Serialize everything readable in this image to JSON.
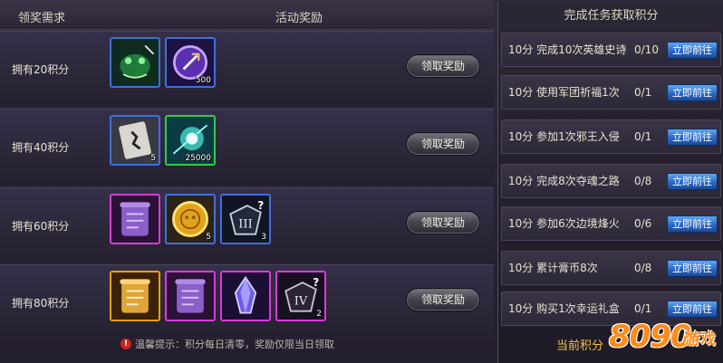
{
  "header": {
    "col_requirement": "领奖需求",
    "col_rewards": "活动奖励"
  },
  "rows": [
    {
      "label": "拥有20积分",
      "button": "领取奖励",
      "items": [
        {
          "icon": "green-beast-icon",
          "frame": "blue",
          "qty": ""
        },
        {
          "icon": "purple-sword-orb-icon",
          "frame": "blue",
          "qty": "500"
        }
      ]
    },
    {
      "label": "拥有40积分",
      "button": "领取奖励",
      "items": [
        {
          "icon": "scroll-figure-icon",
          "frame": "blue",
          "qty": "5"
        },
        {
          "icon": "cyan-energy-burst-icon",
          "frame": "green",
          "qty": "25000"
        }
      ]
    },
    {
      "label": "拥有60积分",
      "button": "领取奖励",
      "items": [
        {
          "icon": "purple-scroll-icon",
          "frame": "purple",
          "qty": ""
        },
        {
          "icon": "gold-coin-icon",
          "frame": "blue",
          "qty": "5"
        },
        {
          "icon": "rune-stone-iii-icon",
          "frame": "blue",
          "qty": "3"
        }
      ]
    },
    {
      "label": "拥有80积分",
      "button": "领取奖励",
      "items": [
        {
          "icon": "gold-scroll-icon",
          "frame": "orange",
          "qty": ""
        },
        {
          "icon": "purple-scroll-icon",
          "frame": "purple",
          "qty": ""
        },
        {
          "icon": "purple-crystal-icon",
          "frame": "purple",
          "qty": ""
        },
        {
          "icon": "rune-stone-iv-icon",
          "frame": "purple",
          "qty": "2"
        }
      ]
    }
  ],
  "tip": "温馨提示：积分每日清零，奖励仅限当日领取",
  "tasks": {
    "title": "完成任务获取积分",
    "go_label": "立即前往",
    "items": [
      {
        "text": "10分 完成10次英雄史诗",
        "progress": "0/10"
      },
      {
        "text": "10分 使用军团祈福1次",
        "progress": "0/1"
      },
      {
        "text": "10分 参加1次邪王入侵",
        "progress": "0/1"
      },
      {
        "text": "10分 完成8次夺魂之路",
        "progress": "0/8"
      },
      {
        "text": "10分 参加6次边境烽火",
        "progress": "0/6"
      },
      {
        "text": "10分 累计膏币8次",
        "progress": "0/8"
      },
      {
        "text": "10分 购买1次幸运礼盒",
        "progress": "0/1"
      }
    ]
  },
  "current_points_label": "当前积分",
  "logo": {
    "num": "8090",
    "text": "游戏"
  }
}
